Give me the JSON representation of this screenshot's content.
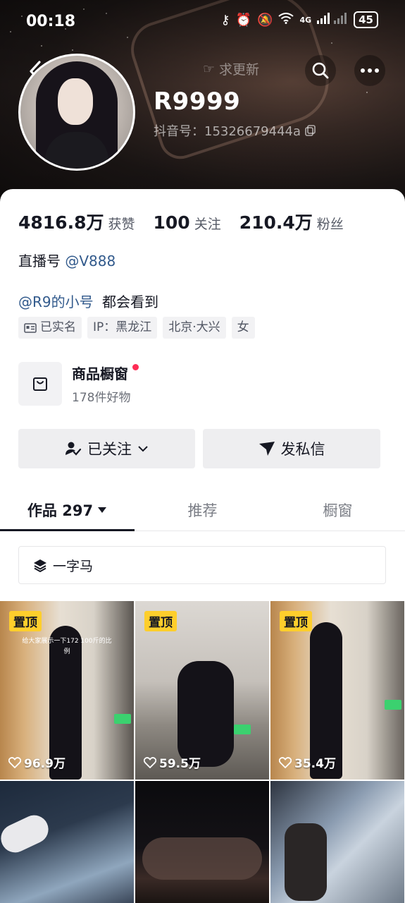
{
  "status_bar": {
    "time": "00:18",
    "network": "4G",
    "battery": "45"
  },
  "header": {
    "request_update": "求更新",
    "name": "R9999",
    "douyin_id": "抖音号：15326679444a"
  },
  "stats": [
    {
      "num": "4816.8万",
      "label": "获赞"
    },
    {
      "num": "100",
      "label": "关注"
    },
    {
      "num": "210.4万",
      "label": "粉丝"
    }
  ],
  "live": {
    "label": "直播号",
    "handle": "@V888"
  },
  "bio": {
    "mention": "@R9的小号",
    "text": "都会看到"
  },
  "tags": [
    "已实名",
    "IP：黑龙江",
    "北京·大兴",
    "女"
  ],
  "shop": {
    "title": "商品橱窗",
    "sub": "178件好物"
  },
  "buttons": {
    "follow": "已关注",
    "message": "发私信"
  },
  "tabs": [
    {
      "label": "作品 297"
    },
    {
      "label": "推荐"
    },
    {
      "label": "橱窗"
    }
  ],
  "collection": {
    "label": "一字马"
  },
  "videos": [
    {
      "pinned": "置顶",
      "likes": "96.9万",
      "caption": "给大家展示一下172 100斤的比例"
    },
    {
      "pinned": "置顶",
      "likes": "59.5万"
    },
    {
      "pinned": "置顶",
      "likes": "35.4万"
    }
  ],
  "colors": {
    "accent_red": "#fe2c55",
    "pin_yellow": "#fece2c",
    "link_blue": "#325a8c"
  },
  "icons": [
    "back-arrow-icon",
    "hand-point-icon",
    "search-icon",
    "more-icon",
    "copy-icon",
    "id-card-icon",
    "bag-icon",
    "person-check-icon",
    "chevron-down-icon",
    "send-icon",
    "caret-down-icon",
    "layers-icon",
    "heart-icon"
  ]
}
